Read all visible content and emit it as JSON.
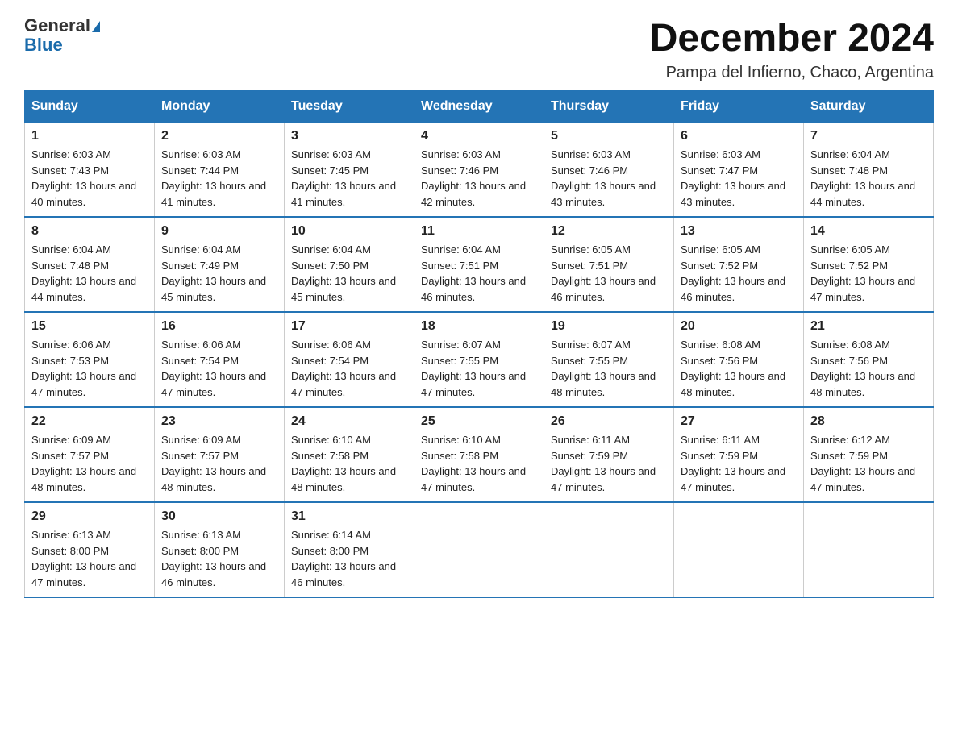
{
  "header": {
    "logo_general": "General",
    "logo_blue": "Blue",
    "title": "December 2024",
    "subtitle": "Pampa del Infierno, Chaco, Argentina"
  },
  "days_of_week": [
    "Sunday",
    "Monday",
    "Tuesday",
    "Wednesday",
    "Thursday",
    "Friday",
    "Saturday"
  ],
  "weeks": [
    [
      {
        "day": "1",
        "sunrise": "6:03 AM",
        "sunset": "7:43 PM",
        "daylight": "13 hours and 40 minutes."
      },
      {
        "day": "2",
        "sunrise": "6:03 AM",
        "sunset": "7:44 PM",
        "daylight": "13 hours and 41 minutes."
      },
      {
        "day": "3",
        "sunrise": "6:03 AM",
        "sunset": "7:45 PM",
        "daylight": "13 hours and 41 minutes."
      },
      {
        "day": "4",
        "sunrise": "6:03 AM",
        "sunset": "7:46 PM",
        "daylight": "13 hours and 42 minutes."
      },
      {
        "day": "5",
        "sunrise": "6:03 AM",
        "sunset": "7:46 PM",
        "daylight": "13 hours and 43 minutes."
      },
      {
        "day": "6",
        "sunrise": "6:03 AM",
        "sunset": "7:47 PM",
        "daylight": "13 hours and 43 minutes."
      },
      {
        "day": "7",
        "sunrise": "6:04 AM",
        "sunset": "7:48 PM",
        "daylight": "13 hours and 44 minutes."
      }
    ],
    [
      {
        "day": "8",
        "sunrise": "6:04 AM",
        "sunset": "7:48 PM",
        "daylight": "13 hours and 44 minutes."
      },
      {
        "day": "9",
        "sunrise": "6:04 AM",
        "sunset": "7:49 PM",
        "daylight": "13 hours and 45 minutes."
      },
      {
        "day": "10",
        "sunrise": "6:04 AM",
        "sunset": "7:50 PM",
        "daylight": "13 hours and 45 minutes."
      },
      {
        "day": "11",
        "sunrise": "6:04 AM",
        "sunset": "7:51 PM",
        "daylight": "13 hours and 46 minutes."
      },
      {
        "day": "12",
        "sunrise": "6:05 AM",
        "sunset": "7:51 PM",
        "daylight": "13 hours and 46 minutes."
      },
      {
        "day": "13",
        "sunrise": "6:05 AM",
        "sunset": "7:52 PM",
        "daylight": "13 hours and 46 minutes."
      },
      {
        "day": "14",
        "sunrise": "6:05 AM",
        "sunset": "7:52 PM",
        "daylight": "13 hours and 47 minutes."
      }
    ],
    [
      {
        "day": "15",
        "sunrise": "6:06 AM",
        "sunset": "7:53 PM",
        "daylight": "13 hours and 47 minutes."
      },
      {
        "day": "16",
        "sunrise": "6:06 AM",
        "sunset": "7:54 PM",
        "daylight": "13 hours and 47 minutes."
      },
      {
        "day": "17",
        "sunrise": "6:06 AM",
        "sunset": "7:54 PM",
        "daylight": "13 hours and 47 minutes."
      },
      {
        "day": "18",
        "sunrise": "6:07 AM",
        "sunset": "7:55 PM",
        "daylight": "13 hours and 47 minutes."
      },
      {
        "day": "19",
        "sunrise": "6:07 AM",
        "sunset": "7:55 PM",
        "daylight": "13 hours and 48 minutes."
      },
      {
        "day": "20",
        "sunrise": "6:08 AM",
        "sunset": "7:56 PM",
        "daylight": "13 hours and 48 minutes."
      },
      {
        "day": "21",
        "sunrise": "6:08 AM",
        "sunset": "7:56 PM",
        "daylight": "13 hours and 48 minutes."
      }
    ],
    [
      {
        "day": "22",
        "sunrise": "6:09 AM",
        "sunset": "7:57 PM",
        "daylight": "13 hours and 48 minutes."
      },
      {
        "day": "23",
        "sunrise": "6:09 AM",
        "sunset": "7:57 PM",
        "daylight": "13 hours and 48 minutes."
      },
      {
        "day": "24",
        "sunrise": "6:10 AM",
        "sunset": "7:58 PM",
        "daylight": "13 hours and 48 minutes."
      },
      {
        "day": "25",
        "sunrise": "6:10 AM",
        "sunset": "7:58 PM",
        "daylight": "13 hours and 47 minutes."
      },
      {
        "day": "26",
        "sunrise": "6:11 AM",
        "sunset": "7:59 PM",
        "daylight": "13 hours and 47 minutes."
      },
      {
        "day": "27",
        "sunrise": "6:11 AM",
        "sunset": "7:59 PM",
        "daylight": "13 hours and 47 minutes."
      },
      {
        "day": "28",
        "sunrise": "6:12 AM",
        "sunset": "7:59 PM",
        "daylight": "13 hours and 47 minutes."
      }
    ],
    [
      {
        "day": "29",
        "sunrise": "6:13 AM",
        "sunset": "8:00 PM",
        "daylight": "13 hours and 47 minutes."
      },
      {
        "day": "30",
        "sunrise": "6:13 AM",
        "sunset": "8:00 PM",
        "daylight": "13 hours and 46 minutes."
      },
      {
        "day": "31",
        "sunrise": "6:14 AM",
        "sunset": "8:00 PM",
        "daylight": "13 hours and 46 minutes."
      },
      null,
      null,
      null,
      null
    ]
  ]
}
